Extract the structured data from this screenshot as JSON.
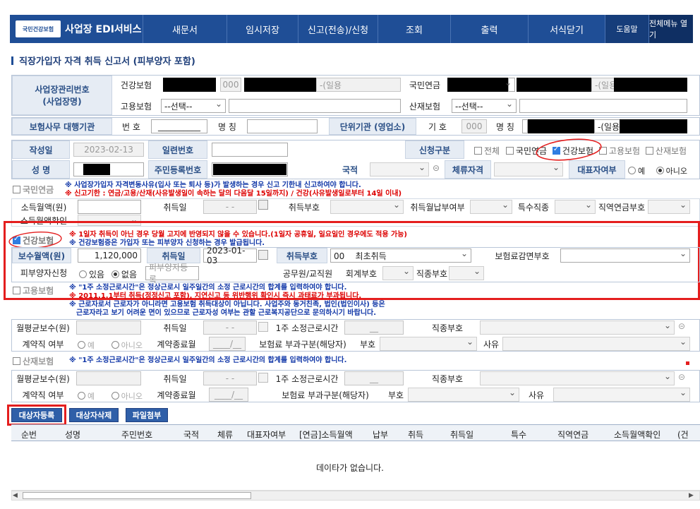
{
  "nav": {
    "logo_emblem": "국민건강보험",
    "title": "사업장 EDI서비스",
    "menu": [
      "새문서",
      "임시저장",
      "신고(전송)/신청",
      "조회",
      "출력",
      "서식닫기"
    ],
    "help": "도움말",
    "all_menu": "전체메뉴 열기"
  },
  "page_title": "직장가입자 자격 취득 신고서 (피부양자 포함)",
  "biz": {
    "label": "사업장관리번호\n(사업장명)",
    "health_label": "건강보험",
    "health_num": "000",
    "health_suffix": "-(일용",
    "pension_label": "국민연금",
    "pension_suffix": "-(일용",
    "employment_label": "고용보험",
    "employment_select": "--선택--",
    "accident_label": "산재보험",
    "accident_select": "--선택--"
  },
  "agency": {
    "label": "보험사무 대행기관",
    "num_label": "번 호",
    "num_value": "__________",
    "name_label": "명 칭",
    "unit_label": "단위기관 (영업소)",
    "code_label": "기 호",
    "code_value": "000",
    "unit_name_label": "명 칭",
    "unit_suffix": "-(일용"
  },
  "form": {
    "date_label": "작성일",
    "date_value": "2023-02-13",
    "serial_label": "일련번호",
    "apply_label": "신청구분",
    "apply_opts": [
      "전체",
      "국민연금",
      "건강보험",
      "고용보험",
      "산재보험"
    ],
    "name_label": "성 명",
    "rrn_label": "주민등록번호",
    "nation_label": "국적",
    "stay_label": "체류자격",
    "rep_label": "대표자여부",
    "rep_yes": "예",
    "rep_no": "아니오"
  },
  "pension": {
    "header": "국민연금",
    "note1": "※ 사업장가입자 자격변동사유(입사 또는 퇴사 등)가 발생하는 경우 신고 기한내 신고하여야 합니다.",
    "note2": "※ 신고기한 : 연금/고용/산재(사유발생일이 속하는 달의 다음달 15일까지) / 건강(사유발생일로부터 14일 이내)",
    "income_label": "소득월액(원)",
    "acq_date_label": "취득일",
    "acq_date_value": "- -",
    "acq_code_label": "취득부호",
    "pay_label": "취득월납부여부",
    "special_label": "특수직종",
    "occ_label": "직역연금부호",
    "confirm_label": "소득월액확인"
  },
  "health": {
    "header": "건강보험",
    "note1": "※ 1일자 취득이 아닌 경우 당월 고지에 반영되지 않을 수 있습니다.(1일자 공휴일, 일요일인 경우에도 적용 가능)",
    "note2": "※ 건강보험증은 가입자 또는 피부양자 신청하는 경우 발급됩니다.",
    "pay_label": "보수월액(원)",
    "pay_value": "1,120,000",
    "acq_date_label": "취득일",
    "acq_date_value": "2023-01-03",
    "acq_code_label": "취득부호",
    "acq_code_value": "00    최초취득",
    "reduce_label": "보험료감면부호",
    "dependent_label": "피부양자신청",
    "dep_yes": "있음",
    "dep_no": "없음",
    "dep_reg": "피부양자등록",
    "civil_label": "공무원/교직원",
    "account_label": "회계부호",
    "job_label": "직종부호"
  },
  "employment": {
    "header": "고용보험",
    "note1": "※ \"1주 소정근로시간\"은 정상근로시 일주일간의 소정 근로시간의 합계를 입력하여야 합니다.",
    "note2": "※ 2011.1.1부터 취득(정정신고 포함), 지연신고 등 위반행위 확인시 즉시 과태료가 부과됩니다.",
    "note3": "※ 근로자로서 근로자가 아니라면 고용보험 취득대상이 아닙니다. 사업주와 동거친족, 법인(법인이사) 등은",
    "note4": "근로자라고 보기 어려운 면이 있으므로 근로자성 여부는 관할 근로복지공단으로 문의하시기 바랍니다.",
    "wage_label": "월평균보수(원)",
    "acq_date_label": "취득일",
    "acq_date_value": "- -",
    "hours_label": "1주 소정근로시간",
    "hours_value": "__",
    "job_label": "직종부호",
    "contract_label": "계약직 여부",
    "yes": "예",
    "no": "아니오",
    "end_label": "계약종료월",
    "end_value": "____/__",
    "levy_label": "보험료 부과구분(해당자)",
    "code_label": "부호",
    "reason_label": "사유"
  },
  "accident": {
    "header": "산재보험",
    "note1": "※ \"1주 소정근로시간\"은 정상근로시 일주일간의 소정 근로시간의 합계를 입력하여야 합니다.",
    "wage_label": "월평균보수(원)",
    "acq_date_label": "취득일",
    "acq_date_value": "- -",
    "hours_label": "1주 소정근로시간",
    "hours_value": "__",
    "job_label": "직종부호",
    "contract_label": "계약직 여부",
    "yes": "예",
    "no": "아니오",
    "end_label": "계약종료월",
    "end_value": "____/__",
    "levy_label": "보험료 부과구분(해당자)",
    "code_label": "부호",
    "reason_label": "사유"
  },
  "buttons": {
    "register": "대상자등록",
    "delete": "대상자삭제",
    "attach": "파일첨부"
  },
  "grid": {
    "columns": [
      "순번",
      "성명",
      "주민번호",
      "국적",
      "체류",
      "대표자여부",
      "[연금]소득월액",
      "납부",
      "취득",
      "취득일",
      "특수",
      "직역연금",
      "소득월액확인",
      "(건"
    ],
    "empty": "데이타가 없습니다."
  }
}
